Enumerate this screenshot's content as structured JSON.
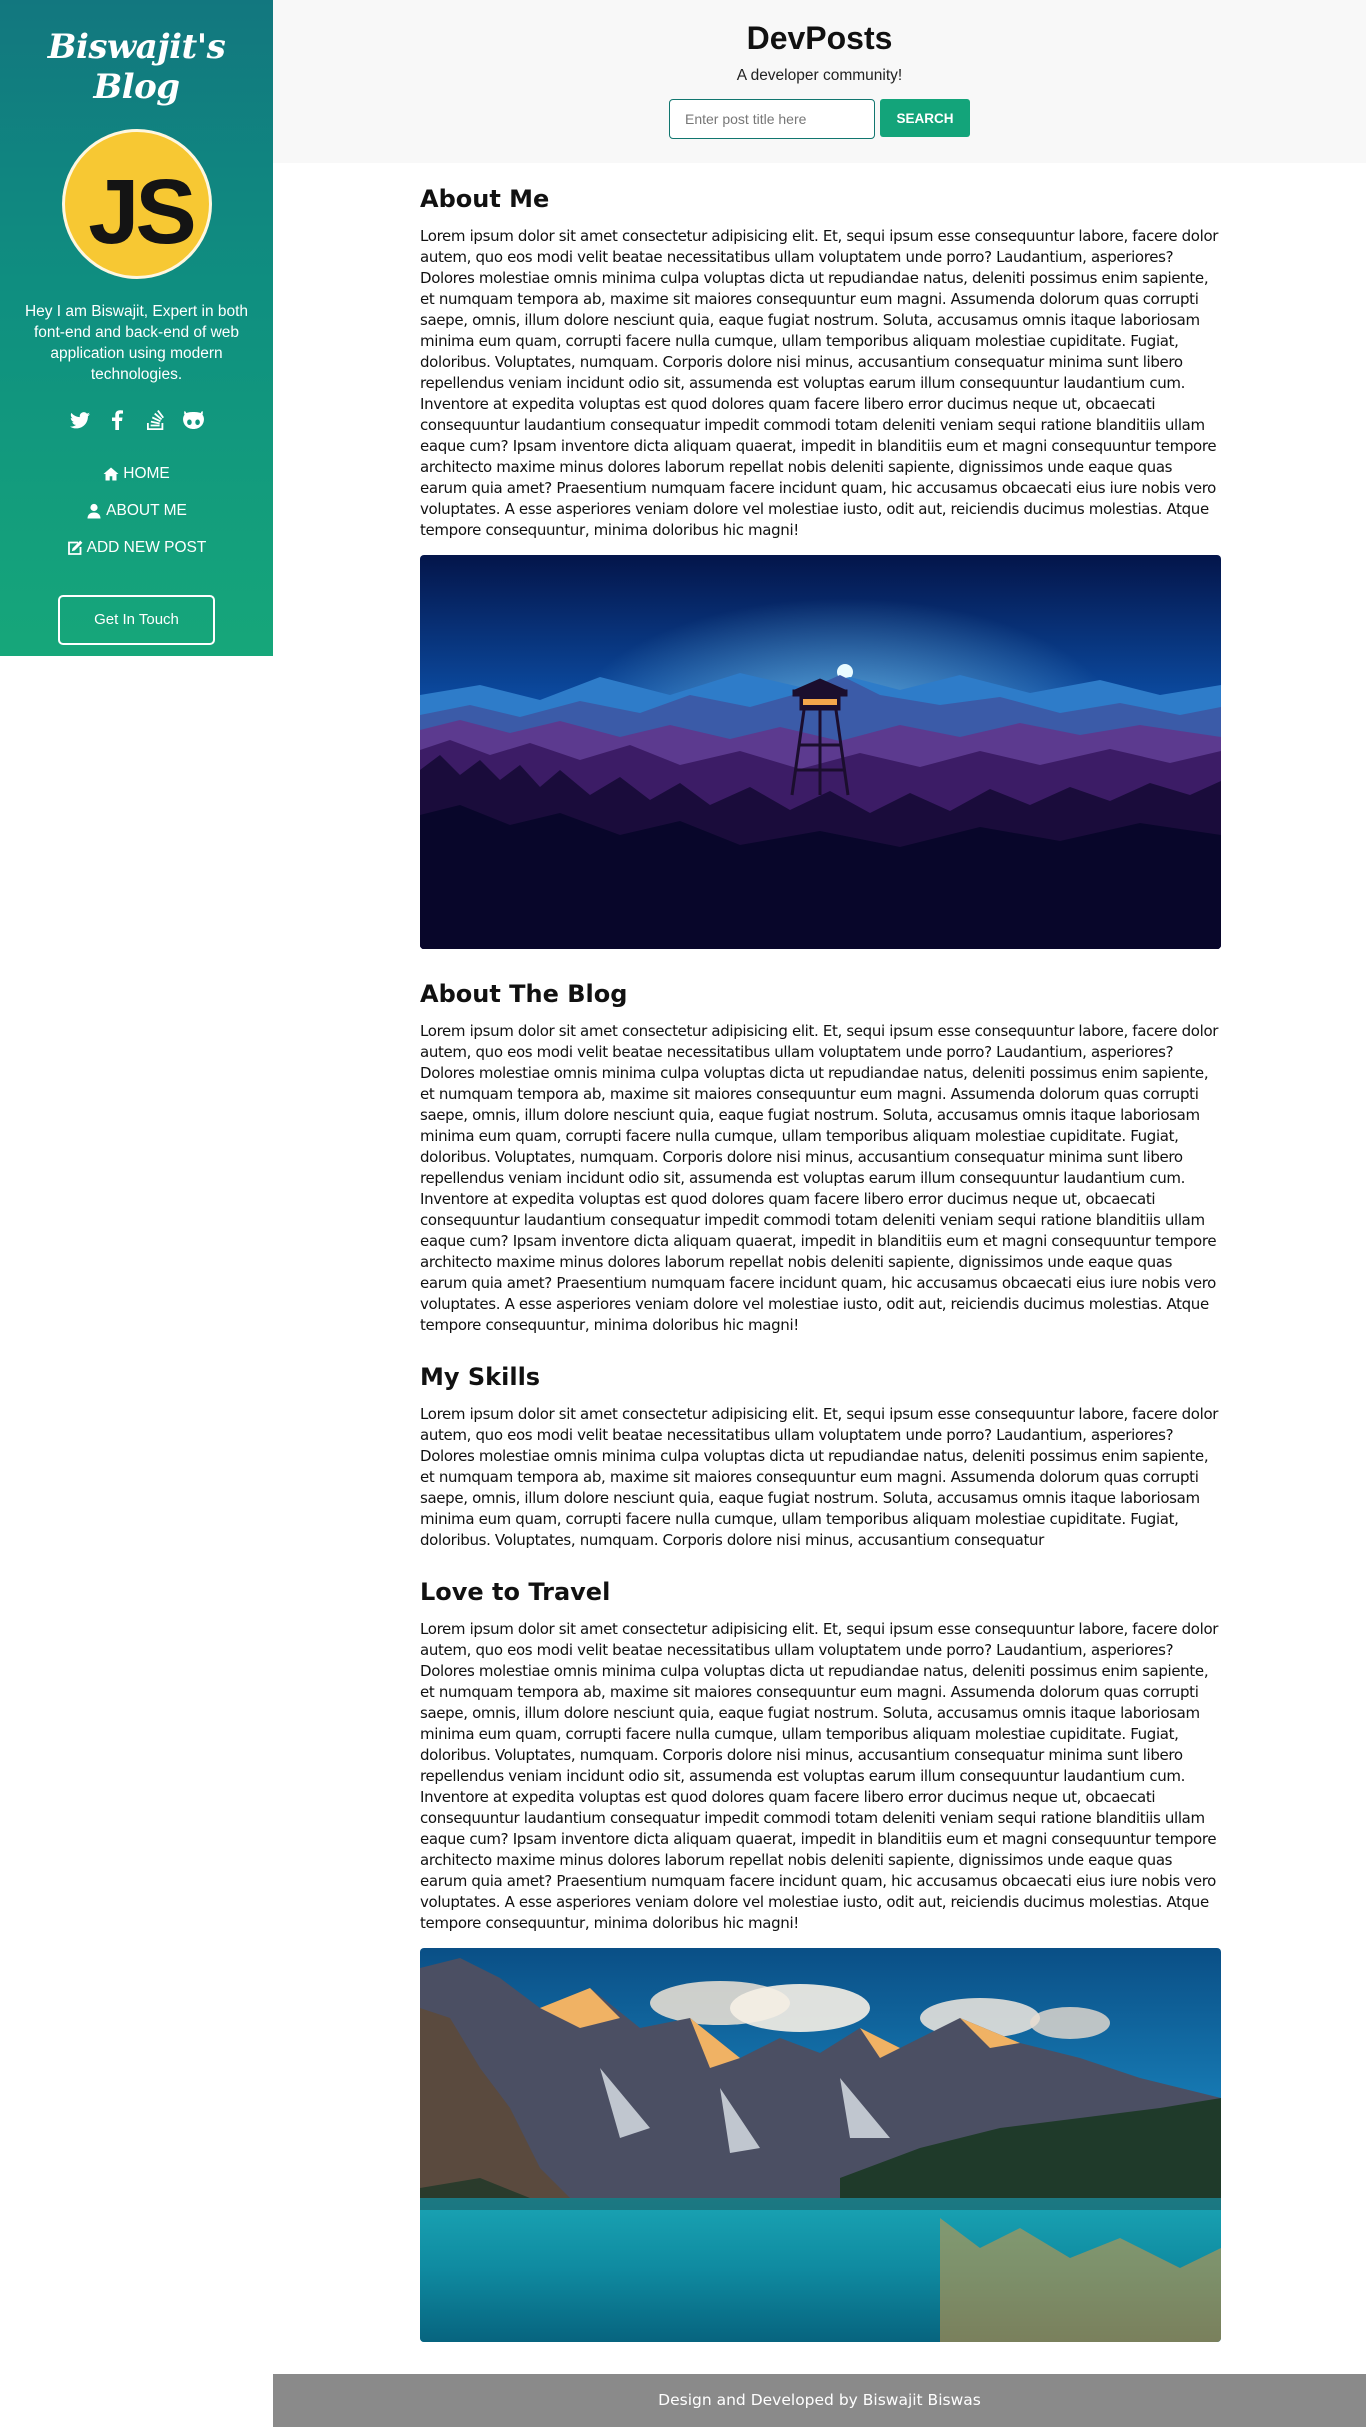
{
  "sidebar": {
    "brand": "Biswajit's Blog",
    "avatar_text": "JS",
    "bio": "Hey I am Biswajit, Expert in both font-end and back-end of web application using modern technologies.",
    "socials": [
      "twitter-icon",
      "facebook-icon",
      "stackoverflow-icon",
      "github-icon"
    ],
    "nav": [
      {
        "icon": "home-icon",
        "label": "HOME"
      },
      {
        "icon": "user-icon",
        "label": "ABOUT ME"
      },
      {
        "icon": "edit-icon",
        "label": "ADD NEW POST"
      }
    ],
    "contact_label": "Get In Touch",
    "colors": {
      "gradient_top": "#12777f",
      "gradient_bottom": "#16a77a"
    }
  },
  "header": {
    "title": "DevPosts",
    "tagline": "A developer community!",
    "search_placeholder": "Enter post title here",
    "search_button": "SEARCH",
    "colors": {
      "button": "#13a47a"
    }
  },
  "sections": [
    {
      "heading": "About Me",
      "text": "Lorem ipsum dolor sit amet consectetur adipisicing elit. Et, sequi ipsum esse consequuntur labore, facere dolor autem, quo eos modi velit beatae necessitatibus ullam voluptatem unde porro? Laudantium, asperiores? Dolores molestiae omnis minima culpa voluptas dicta ut repudiandae natus, deleniti possimus enim sapiente, et numquam tempora ab, maxime sit maiores consequuntur eum magni. Assumenda dolorum quas corrupti saepe, omnis, illum dolore nesciunt quia, eaque fugiat nostrum. Soluta, accusamus omnis itaque laboriosam minima eum quam, corrupti facere nulla cumque, ullam temporibus aliquam molestiae cupiditate. Fugiat, doloribus. Voluptates, numquam. Corporis dolore nisi minus, accusantium consequatur minima sunt libero repellendus veniam incidunt odio sit, assumenda est voluptas earum illum consequuntur laudantium cum. Inventore at expedita voluptas est quod dolores quam facere libero error ducimus neque ut, obcaecati consequuntur laudantium consequatur impedit commodi totam deleniti veniam sequi ratione blanditiis ullam eaque cum? Ipsam inventore dicta aliquam quaerat, impedit in blanditiis eum et magni consequuntur tempore architecto maxime minus dolores laborum repellat nobis deleniti sapiente, dignissimos unde eaque quas earum quia amet? Praesentium numquam facere incidunt quam, hic accusamus obcaecati eius iure nobis vero voluptates. A esse asperiores veniam dolore vel molestiae iusto, odit aut, reiciendis ducimus molestias. Atque tempore consequuntur, minima doloribus hic magni!"
    },
    {
      "heading": "About The Blog",
      "text": "Lorem ipsum dolor sit amet consectetur adipisicing elit. Et, sequi ipsum esse consequuntur labore, facere dolor autem, quo eos modi velit beatae necessitatibus ullam voluptatem unde porro? Laudantium, asperiores? Dolores molestiae omnis minima culpa voluptas dicta ut repudiandae natus, deleniti possimus enim sapiente, et numquam tempora ab, maxime sit maiores consequuntur eum magni. Assumenda dolorum quas corrupti saepe, omnis, illum dolore nesciunt quia, eaque fugiat nostrum. Soluta, accusamus omnis itaque laboriosam minima eum quam, corrupti facere nulla cumque, ullam temporibus aliquam molestiae cupiditate. Fugiat, doloribus. Voluptates, numquam. Corporis dolore nisi minus, accusantium consequatur minima sunt libero repellendus veniam incidunt odio sit, assumenda est voluptas earum illum consequuntur laudantium cum. Inventore at expedita voluptas est quod dolores quam facere libero error ducimus neque ut, obcaecati consequuntur laudantium consequatur impedit commodi totam deleniti veniam sequi ratione blanditiis ullam eaque cum? Ipsam inventore dicta aliquam quaerat, impedit in blanditiis eum et magni consequuntur tempore architecto maxime minus dolores laborum repellat nobis deleniti sapiente, dignissimos unde eaque quas earum quia amet? Praesentium numquam facere incidunt quam, hic accusamus obcaecati eius iure nobis vero voluptates. A esse asperiores veniam dolore vel molestiae iusto, odit aut, reiciendis ducimus molestias. Atque tempore consequuntur, minima doloribus hic magni!"
    },
    {
      "heading": "My Skills",
      "text": "Lorem ipsum dolor sit amet consectetur adipisicing elit. Et, sequi ipsum esse consequuntur labore, facere dolor autem, quo eos modi velit beatae necessitatibus ullam voluptatem unde porro? Laudantium, asperiores? Dolores molestiae omnis minima culpa voluptas dicta ut repudiandae natus, deleniti possimus enim sapiente, et numquam tempora ab, maxime sit maiores consequuntur eum magni. Assumenda dolorum quas corrupti saepe, omnis, illum dolore nesciunt quia, eaque fugiat nostrum. Soluta, accusamus omnis itaque laboriosam minima eum quam, corrupti facere nulla cumque, ullam temporibus aliquam molestiae cupiditate. Fugiat, doloribus. Voluptates, numquam. Corporis dolore nisi minus, accusantium consequatur"
    },
    {
      "heading": "Love to Travel",
      "text": "Lorem ipsum dolor sit amet consectetur adipisicing elit. Et, sequi ipsum esse consequuntur labore, facere dolor autem, quo eos modi velit beatae necessitatibus ullam voluptatem unde porro? Laudantium, asperiores? Dolores molestiae omnis minima culpa voluptas dicta ut repudiandae natus, deleniti possimus enim sapiente, et numquam tempora ab, maxime sit maiores consequuntur eum magni. Assumenda dolorum quas corrupti saepe, omnis, illum dolore nesciunt quia, eaque fugiat nostrum. Soluta, accusamus omnis itaque laboriosam minima eum quam, corrupti facere nulla cumque, ullam temporibus aliquam molestiae cupiditate. Fugiat, doloribus. Voluptates, numquam. Corporis dolore nisi minus, accusantium consequatur minima sunt libero repellendus veniam incidunt odio sit, assumenda est voluptas earum illum consequuntur laudantium cum. Inventore at expedita voluptas est quod dolores quam facere libero error ducimus neque ut, obcaecati consequuntur laudantium consequatur impedit commodi totam deleniti veniam sequi ratione blanditiis ullam eaque cum? Ipsam inventore dicta aliquam quaerat, impedit in blanditiis eum et magni consequuntur tempore architecto maxime minus dolores laborum repellat nobis deleniti sapiente, dignissimos unde eaque quas earum quia amet? Praesentium numquam facere incidunt quam, hic accusamus obcaecati eius iure nobis vero voluptates. A esse asperiores veniam dolore vel molestiae iusto, odit aut, reiciendis ducimus molestias. Atque tempore consequuntur, minima doloribus hic magni!"
    }
  ],
  "footer": {
    "text": "Design and Developed by Biswajit Biswas",
    "color": "#8a8a8a"
  }
}
